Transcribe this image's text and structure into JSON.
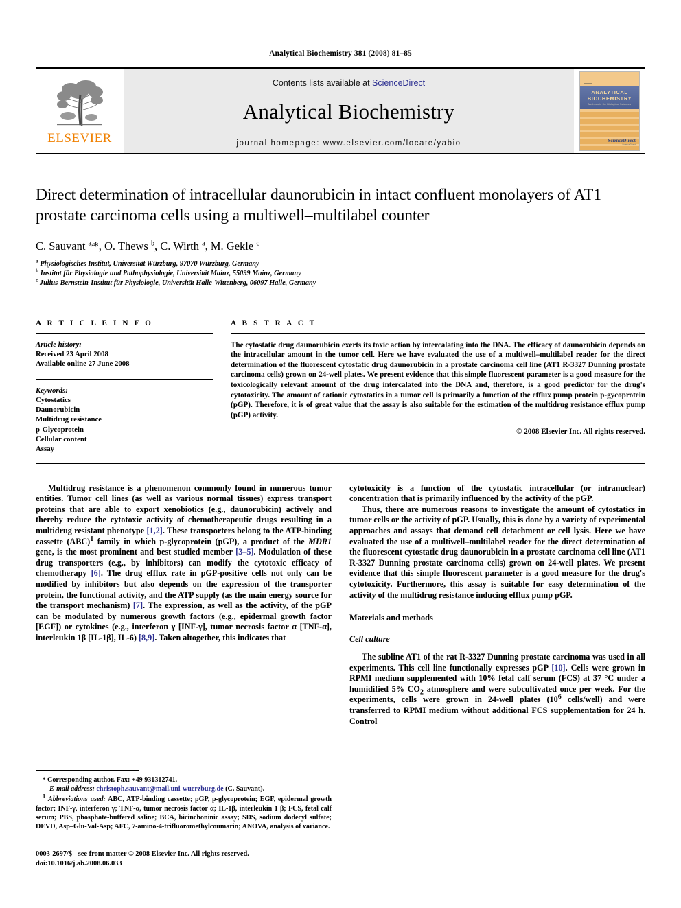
{
  "running_head": "Analytical Biochemistry 381 (2008) 81–85",
  "masthead": {
    "contents_prefix": "Contents lists available at ",
    "sciencedirect": "ScienceDirect",
    "journal_name": "Analytical Biochemistry",
    "homepage": "journal homepage: www.elsevier.com/locate/yabio",
    "publisher_logo_text": "ELSEVIER",
    "cover": {
      "line1": "ANALYTICAL",
      "line2": "BIOCHEMISTRY",
      "subtitle": "Methods in the Biological Sciences",
      "badge_small": "ScienceDirect",
      "badge_name": "ScienceDirect"
    },
    "colors": {
      "sciencedirect_blue": "#2E3192",
      "elsevier_orange": "#F08000",
      "masthead_grey": "#eaeaea",
      "cover_band_blue": "#4d5f92"
    }
  },
  "article": {
    "title": "Direct determination of intracellular daunorubicin in intact confluent monolayers of AT1 prostate carcinoma cells using a multiwell–multilabel counter",
    "authors_html": "C. Sauvant <sup>a,</sup>*, O. Thews <sup>b</sup>, C. Wirth <sup>a</sup>, M. Gekle <sup>c</sup>",
    "affiliations": [
      "Physiologisches Institut, Universität Würzburg, 97070 Würzburg, Germany",
      "Institut für Physiologie und Pathophysiologie, Universität Mainz, 55099 Mainz, Germany",
      "Julius-Bernstein-Institut für Physiologie, Universität Halle-Wittenberg, 06097 Halle, Germany"
    ],
    "affiliation_markers": [
      "a",
      "b",
      "c"
    ]
  },
  "article_info": {
    "heading": "A R T I C L E   I N F O",
    "history_label": "Article history:",
    "received": "Received 23 April 2008",
    "available_online": "Available online 27 June 2008",
    "keywords_label": "Keywords:",
    "keywords": [
      "Cytostatics",
      "Daunorubicin",
      "Multidrug resistance",
      "p-Glycoprotein",
      "Cellular content",
      "Assay"
    ]
  },
  "abstract": {
    "heading": "A B S T R A C T",
    "text": "The cytostatic drug daunorubicin exerts its toxic action by intercalating into the DNA. The efficacy of daunorubicin depends on the intracellular amount in the tumor cell. Here we have evaluated the use of a multiwell–multilabel reader for the direct determination of the fluorescent cytostatic drug daunorubicin in a prostate carcinoma cell line (AT1 R-3327 Dunning prostate carcinoma cells) grown on 24-well plates. We present evidence that this simple fluorescent parameter is a good measure for the toxicologically relevant amount of the drug intercalated into the DNA and, therefore, is a good predictor for the drug's cytotoxicity. The amount of cationic cytostatics in a tumor cell is primarily a function of the efflux pump protein p-gycoprotein (pGP). Therefore, it is of great value that the assay is also suitable for the estimation of the multidrug resistance efflux pump (pGP) activity.",
    "copyright": "© 2008 Elsevier Inc. All rights reserved."
  },
  "body": {
    "left_para_1_html": "Multidrug resistance is a phenomenon commonly found in numerous tumor entities. Tumor cell lines (as well as various normal tissues) express transport proteins that are able to export xenobiotics (e.g., daunorubicin) actively and thereby reduce the cytotoxic activity of chemotherapeutic drugs resulting in a multidrug resistant phenotype <span class=\"ref\">[1,2]</span>. These transporters belong to the ATP-binding cassette (ABC)<sup>1</sup> family in which p-glycoprotein (pGP), a product of the <span class=\"mdr\">MDR1</span> gene, is the most prominent and best studied member <span class=\"ref\">[3–5]</span>. Modulation of these drug transporters (e.g., by inhibitors) can modify the cytotoxic efficacy of chemotherapy <span class=\"ref\">[6]</span>. The drug efflux rate in pGP-positive cells not only can be modified by inhibitors but also depends on the expression of the transporter protein, the functional activity, and the ATP supply (as the main energy source for the transport mechanism) <span class=\"ref\">[7]</span>. The expression, as well as the activity, of the pGP can be modulated by numerous growth factors (e.g., epidermal growth factor [EGF]) or cytokines (e.g., interferon &#947; [INF-&#947;], tumor necrosis factor &#945; [TNF-&#945;], interleukin 1&#946; [IL-1&#946;], IL-6) <span class=\"ref\">[8,9]</span>. Taken altogether, this indicates that",
    "right_para_1_html": "cytotoxicity is a function of the cytostatic intracellular (or intranuclear) concentration that is primarily influenced by the activity of the pGP.",
    "right_para_2_html": "Thus, there are numerous reasons to investigate the amount of cytostatics in tumor cells or the activity of pGP. Usually, this is done by a variety of experimental approaches and assays that demand cell detachment or cell lysis. Here we have evaluated the use of a multiwell–multilabel reader for the direct determination of the fluorescent cytostatic drug daunorubicin in a prostate carcinoma cell line (AT1 R-3327 Dunning prostate carcinoma cells) grown on 24-well plates. We present evidence that this simple fluorescent parameter is a good measure for the drug's cytotoxicity. Furthermore, this assay is suitable for easy determination of the activity of the multidrug resistance inducing efflux pump pGP.",
    "materials_heading": "Materials and methods",
    "cell_culture_heading": "Cell culture",
    "cell_culture_para_html": "The subline AT1 of the rat R-3327 Dunning prostate carcinoma was used in all experiments. This cell line functionally expresses pGP <span class=\"ref\">[10]</span>. Cells were grown in RPMI medium supplemented with 10% fetal calf serum (FCS) at 37 °C under a humidified 5% CO<sub>2</sub> atmosphere and were subcultivated once per week. For the experiments, cells were grown in 24-well plates (10<sup>6</sup> cells/well) and were transferred to RPMI medium without additional FCS supplementation for 24 h. Control"
  },
  "footnotes": {
    "corresponding_html": "<span class=\"star\">*</span> Corresponding author. Fax: +49 931312741.",
    "email_html": "<span class=\"em\">E-mail address:</span> <span class=\"mail\">christoph.sauvant@mail.uni-wuerzburg.de</span> (C. Sauvant).",
    "abbrev_html": "<sup>1</sup> <span class=\"em\">Abbreviations used:</span> ABC, ATP-binding cassette; pGP, p-glycoprotein; EGF, epidermal growth factor; INF-&#947;, interferon &#947;; TNF-&#945;, tumor necrosis factor &#945;; IL-1&#946;, interleukin 1 &#946;; FCS, fetal calf serum; PBS, phosphate-buffered saline; BCA, bicinchoninic assay; SDS, sodium dodecyl sulfate; DEVD, Asp–Glu-Val-Asp; AFC, 7-amino-4-trifluoromethylcoumarin; ANOVA, analysis of variance.",
    "issn_line": "0003-2697/$ - see front matter © 2008 Elsevier Inc. All rights reserved.",
    "doi_line": "doi:10.1016/j.ab.2008.06.033"
  }
}
